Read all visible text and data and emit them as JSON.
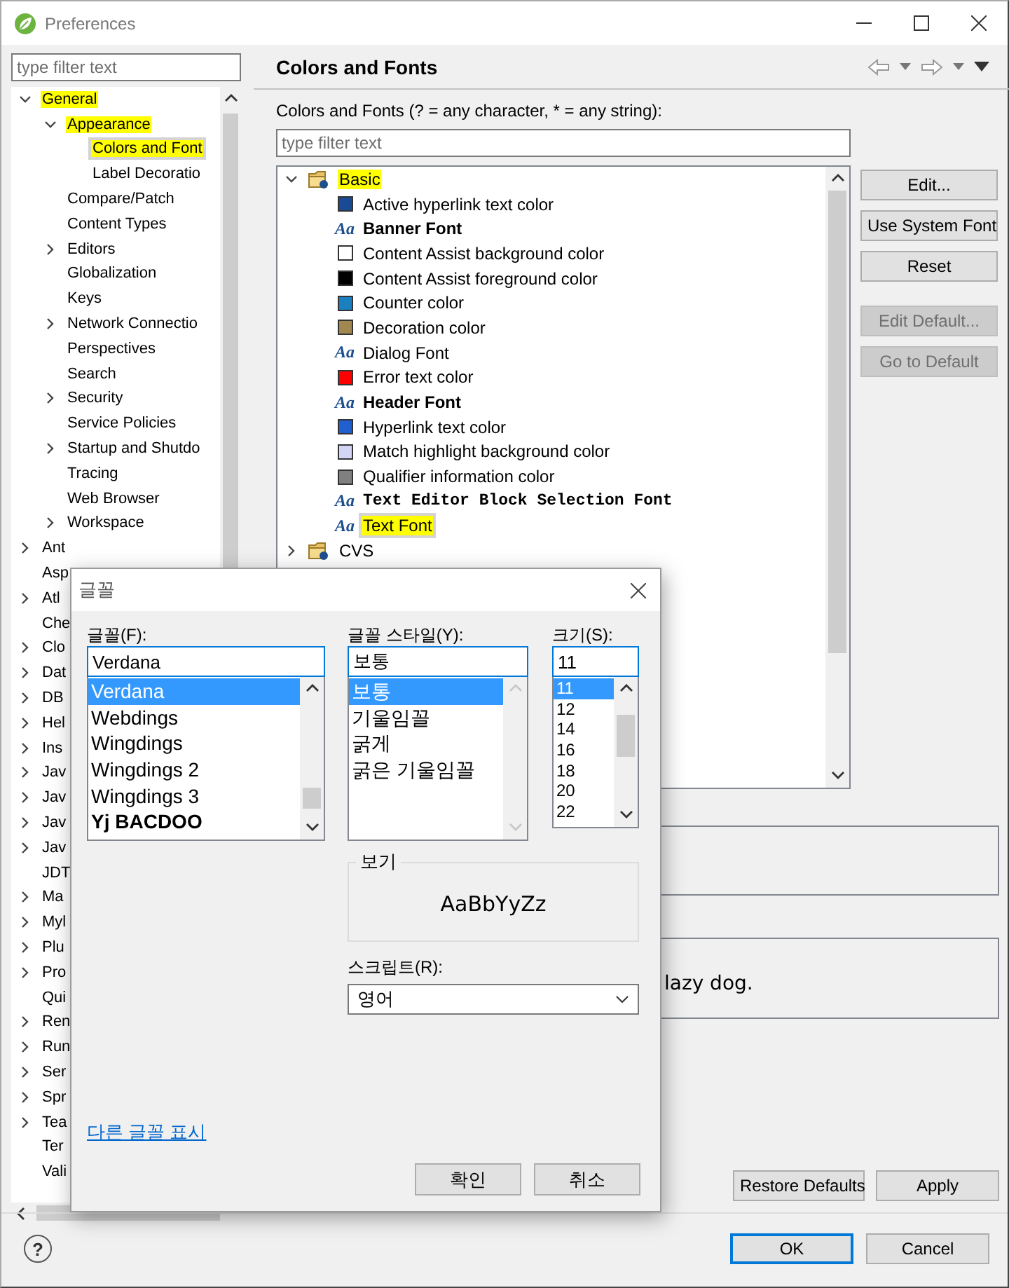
{
  "window": {
    "title": "Preferences"
  },
  "sidebar": {
    "filter": {
      "placeholder": "type filter text"
    },
    "tree": [
      {
        "label": "General",
        "expanded": true,
        "selected": false,
        "highlighted": true,
        "children": [
          {
            "label": "Appearance",
            "expanded": true,
            "selected": false,
            "highlighted": true,
            "children": [
              {
                "label": "Colors and Font",
                "selected": true,
                "highlighted": true
              },
              {
                "label": "Label Decoratio",
                "selected": false,
                "highlighted": false
              }
            ]
          },
          {
            "label": "Compare/Patch",
            "selected": false,
            "highlighted": false
          },
          {
            "label": "Content Types",
            "selected": false,
            "highlighted": false
          },
          {
            "label": "Editors",
            "expanded": false,
            "selected": false,
            "highlighted": false
          },
          {
            "label": "Globalization",
            "selected": false,
            "highlighted": false
          },
          {
            "label": "Keys",
            "selected": false,
            "highlighted": false
          },
          {
            "label": "Network Connectio",
            "expanded": false,
            "selected": false,
            "highlighted": false
          },
          {
            "label": "Perspectives",
            "selected": false,
            "highlighted": false
          },
          {
            "label": "Search",
            "selected": false,
            "highlighted": false
          },
          {
            "label": "Security",
            "expanded": false,
            "selected": false,
            "highlighted": false
          },
          {
            "label": "Service Policies",
            "selected": false,
            "highlighted": false
          },
          {
            "label": "Startup and Shutdo",
            "expanded": false,
            "selected": false,
            "highlighted": false
          },
          {
            "label": "Tracing",
            "selected": false,
            "highlighted": false
          },
          {
            "label": "Web Browser",
            "selected": false,
            "highlighted": false
          },
          {
            "label": "Workspace",
            "expanded": false,
            "selected": false,
            "highlighted": false
          }
        ]
      },
      {
        "label": "Ant",
        "expanded": false,
        "selected": false,
        "highlighted": false
      },
      {
        "label": "Asp",
        "selected": false,
        "highlighted": false
      },
      {
        "label": "Atl",
        "expanded": false,
        "selected": false,
        "highlighted": false
      },
      {
        "label": "Che",
        "selected": false,
        "highlighted": false
      },
      {
        "label": "Clo",
        "expanded": false,
        "selected": false,
        "highlighted": false
      },
      {
        "label": "Dat",
        "expanded": false,
        "selected": false,
        "highlighted": false
      },
      {
        "label": "DB",
        "expanded": false,
        "selected": false,
        "highlighted": false
      },
      {
        "label": "Hel",
        "expanded": false,
        "selected": false,
        "highlighted": false
      },
      {
        "label": "Ins",
        "expanded": false,
        "selected": false,
        "highlighted": false
      },
      {
        "label": "Jav",
        "expanded": false,
        "selected": false,
        "highlighted": false
      },
      {
        "label": "Jav",
        "expanded": false,
        "selected": false,
        "highlighted": false
      },
      {
        "label": "Jav",
        "expanded": false,
        "selected": false,
        "highlighted": false
      },
      {
        "label": "Jav",
        "expanded": false,
        "selected": false,
        "highlighted": false
      },
      {
        "label": "JDT",
        "selected": false,
        "highlighted": false
      },
      {
        "label": "Ma",
        "expanded": false,
        "selected": false,
        "highlighted": false
      },
      {
        "label": "Myl",
        "expanded": false,
        "selected": false,
        "highlighted": false
      },
      {
        "label": "Plu",
        "expanded": false,
        "selected": false,
        "highlighted": false
      },
      {
        "label": "Pro",
        "expanded": false,
        "selected": false,
        "highlighted": false
      },
      {
        "label": "Qui",
        "selected": false,
        "highlighted": false
      },
      {
        "label": "Ren",
        "expanded": false,
        "selected": false,
        "highlighted": false
      },
      {
        "label": "Run",
        "expanded": false,
        "selected": false,
        "highlighted": false
      },
      {
        "label": "Ser",
        "expanded": false,
        "selected": false,
        "highlighted": false
      },
      {
        "label": "Spr",
        "expanded": false,
        "selected": false,
        "highlighted": false
      },
      {
        "label": "Tea",
        "expanded": false,
        "selected": false,
        "highlighted": false
      },
      {
        "label": "Ter",
        "selected": false,
        "highlighted": false
      },
      {
        "label": "Vali",
        "selected": false,
        "highlighted": false
      }
    ]
  },
  "panel": {
    "title": "Colors and Fonts",
    "filter_label": "Colors and Fonts (? = any character, * = any string):",
    "filter": {
      "placeholder": "type filter text"
    },
    "tree": [
      {
        "label": "Basic",
        "expanded": true,
        "selected": false,
        "highlighted": true,
        "children": [
          {
            "label": "Active hyperlink text color",
            "kind": "color",
            "color": "#1a4a94",
            "selected": false,
            "highlighted": false
          },
          {
            "label": "Banner Font",
            "kind": "boldfont",
            "glyph": "Aa",
            "selected": false,
            "highlighted": false
          },
          {
            "label": "Content Assist background color",
            "kind": "color",
            "color": "#ffffff",
            "selected": false,
            "highlighted": false
          },
          {
            "label": "Content Assist foreground color",
            "kind": "color",
            "color": "#000000",
            "selected": false,
            "highlighted": false
          },
          {
            "label": "Counter color",
            "kind": "color",
            "color": "#1b80c0",
            "selected": false,
            "highlighted": false
          },
          {
            "label": "Decoration color",
            "kind": "color",
            "color": "#a08850",
            "selected": false,
            "highlighted": false
          },
          {
            "label": "Dialog Font",
            "kind": "font",
            "glyph": "Aa",
            "selected": false,
            "highlighted": false
          },
          {
            "label": "Error text color",
            "kind": "color",
            "color": "#ff0000",
            "selected": false,
            "highlighted": false
          },
          {
            "label": "Header Font",
            "kind": "boldfont",
            "glyph": "Aa",
            "selected": false,
            "highlighted": false
          },
          {
            "label": "Hyperlink text color",
            "kind": "color",
            "color": "#1f5fd0",
            "selected": false,
            "highlighted": false
          },
          {
            "label": "Match highlight background color",
            "kind": "color",
            "color": "#d4d4f4",
            "selected": false,
            "highlighted": false
          },
          {
            "label": "Qualifier information color",
            "kind": "color",
            "color": "#808080",
            "selected": false,
            "highlighted": false
          },
          {
            "label": "Text Editor Block Selection Font",
            "kind": "monofont",
            "glyph": "Aa",
            "selected": false,
            "highlighted": false
          },
          {
            "label": "Text Font",
            "kind": "font",
            "glyph": "Aa",
            "selected": true,
            "highlighted": true
          }
        ]
      },
      {
        "label": "CVS",
        "expanded": false,
        "selected": false,
        "highlighted": false
      }
    ],
    "buttons": [
      {
        "label": "Edit...",
        "disabled": false
      },
      {
        "label": "Use System Font",
        "disabled": false
      },
      {
        "label": "Reset",
        "disabled": false
      }
    ],
    "default_buttons": [
      {
        "label": "Edit Default...",
        "disabled": true
      },
      {
        "label": "Go to Default",
        "disabled": true
      }
    ],
    "preview": {
      "text": "lazy dog."
    },
    "footer_buttons": [
      "Restore Defaults",
      "Apply"
    ]
  },
  "dialog_buttons": [
    {
      "label": "OK",
      "default": true
    },
    {
      "label": "Cancel",
      "default": false
    }
  ],
  "help": "?",
  "font_dialog": {
    "title": "글꼴",
    "font": {
      "label": "글꼴(F):",
      "value": "Verdana",
      "items": [
        {
          "label": "Verdana",
          "selected": true,
          "kind": "regular"
        },
        {
          "label": "Webdings",
          "selected": false,
          "kind": "regular"
        },
        {
          "label": "Wingdings",
          "selected": false,
          "kind": "regular"
        },
        {
          "label": "Wingdings 2",
          "selected": false,
          "kind": "regular"
        },
        {
          "label": "Wingdings 3",
          "selected": false,
          "kind": "regular"
        },
        {
          "label": "Yj BACDOO",
          "selected": false,
          "kind": "bold"
        }
      ]
    },
    "style": {
      "label": "글꼴 스타일(Y):",
      "value": "보통",
      "items": [
        {
          "label": "보통",
          "selected": true
        },
        {
          "label": "기울임꼴",
          "selected": false
        },
        {
          "label": "굵게",
          "selected": false
        },
        {
          "label": "굵은 기울임꼴",
          "selected": false
        }
      ]
    },
    "size": {
      "label": "크기(S):",
      "value": "11",
      "items": [
        {
          "label": "11",
          "selected": true
        },
        {
          "label": "12",
          "selected": false
        },
        {
          "label": "14",
          "selected": false
        },
        {
          "label": "16",
          "selected": false
        },
        {
          "label": "18",
          "selected": false
        },
        {
          "label": "20",
          "selected": false
        },
        {
          "label": "22",
          "selected": false
        }
      ]
    },
    "sample": {
      "label": "보기",
      "text": "AaBbYyZz"
    },
    "script": {
      "label": "스크립트(R):",
      "value": "영어"
    },
    "link": "다른 글꼴 표시",
    "buttons": [
      "확인",
      "취소"
    ]
  }
}
